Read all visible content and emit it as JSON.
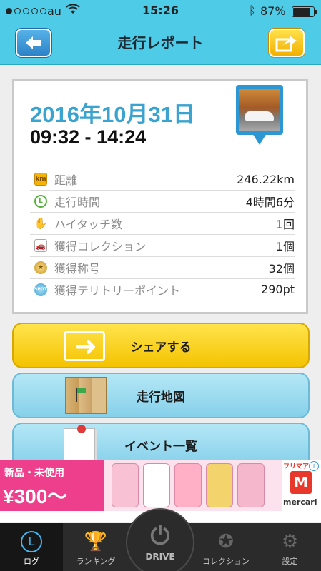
{
  "status_bar": {
    "carrier": "au",
    "time": "15:26",
    "battery": "87%",
    "battery_level": 0.87
  },
  "header": {
    "title": "走行レポート",
    "back_icon": "arrow-left-icon",
    "share_icon": "share-arrow-icon"
  },
  "report": {
    "date": "2016年10月31日",
    "time_range": "09:32 - 14:24",
    "rows": [
      {
        "icon": "km-badge-icon",
        "icon_text": "km",
        "label": "距離",
        "value": "246.22km"
      },
      {
        "icon": "clock-icon",
        "icon_text": "L",
        "label": "走行時間",
        "value": "4時間6分"
      },
      {
        "icon": "hand-icon",
        "icon_text": "✋",
        "label": "ハイタッチ数",
        "value": "1回"
      },
      {
        "icon": "collection-card-icon",
        "icon_text": "🚗",
        "label": "獲得コレクション",
        "value": "1個"
      },
      {
        "icon": "medal-icon",
        "icon_text": "★",
        "label": "獲得称号",
        "value": "32個"
      },
      {
        "icon": "spot-icon",
        "icon_text": "SPOT",
        "label": "獲得テリトリーポイント",
        "value": "290pt"
      }
    ]
  },
  "actions": {
    "share_label": "シェアする",
    "map_label": "走行地図",
    "events_label": "イベント一覧"
  },
  "ad": {
    "tag": "新品・未使用",
    "price": "¥300〜",
    "brand_top": "フリマア",
    "brand": "mercari",
    "info": "i"
  },
  "tabbar": {
    "log": "ログ",
    "ranking": "ランキング",
    "drive": "DRIVE",
    "collection": "コレクション",
    "settings": "設定"
  }
}
